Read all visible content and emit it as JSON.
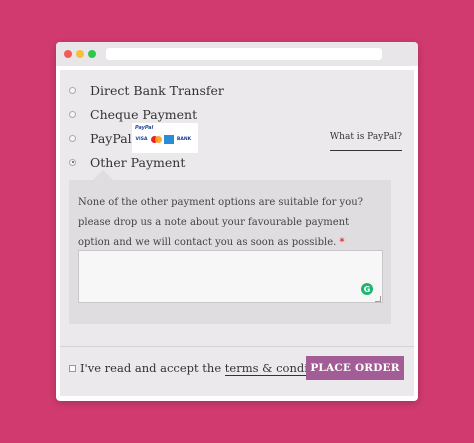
{
  "payment_options": [
    {
      "label": "Direct Bank Transfer",
      "checked": false
    },
    {
      "label": "Cheque Payment",
      "checked": false
    },
    {
      "label": "PayPal",
      "checked": false
    },
    {
      "label": "Other Payment",
      "checked": true
    }
  ],
  "paypal": {
    "logo_text": "PayPal",
    "cards": [
      "VISA",
      "BANK"
    ],
    "what_is_link": "What is PayPal?"
  },
  "other_payment": {
    "description": "None of the other payment options are suitable for you? please drop us a note about your favourable payment option and we will contact you as soon as possible.",
    "required_mark": "*",
    "note_value": ""
  },
  "footer": {
    "terms_prefix": "I've read and accept the ",
    "terms_link": "terms & conditions",
    "place_order_label": "PLACE ORDER"
  },
  "icons": {
    "grammarly": "G"
  },
  "colors": {
    "background": "#d13a6e",
    "place_order": "#a35d96"
  }
}
